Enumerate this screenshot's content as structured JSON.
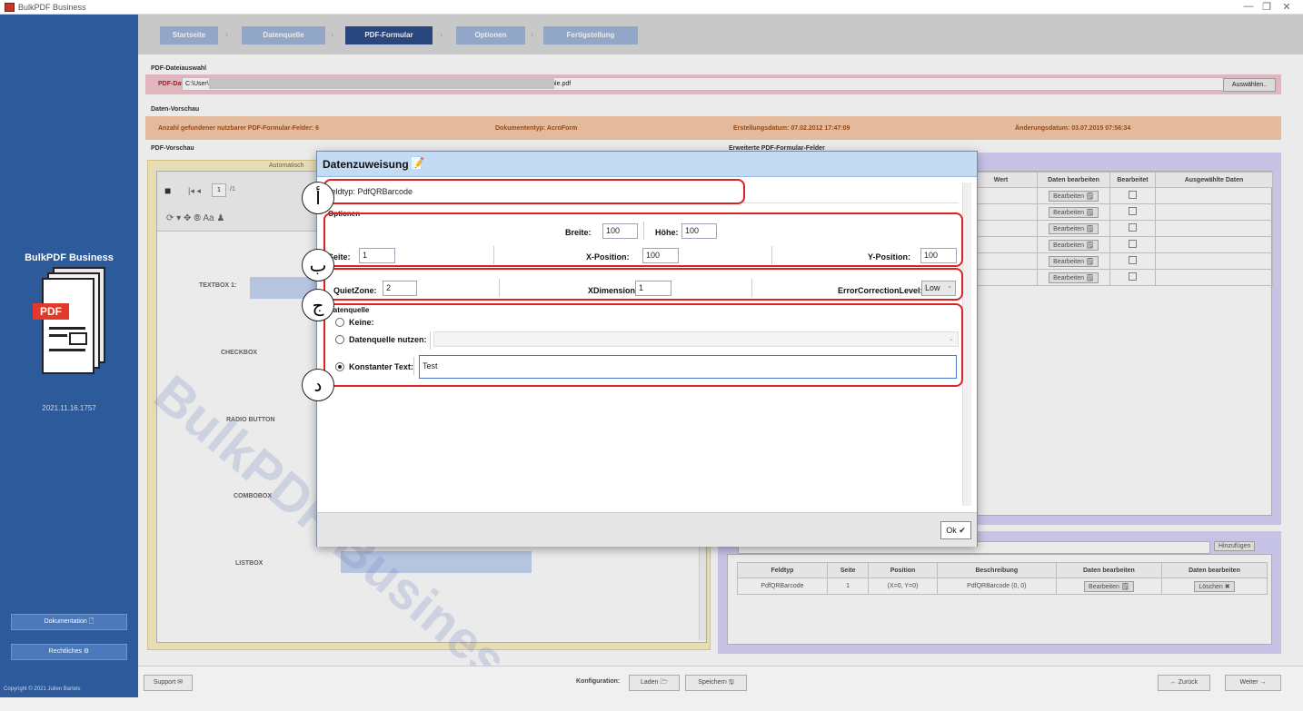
{
  "window": {
    "title": "BulkPDF Business",
    "controls": [
      "—",
      "❐",
      "✕"
    ]
  },
  "sidebar": {
    "brand": "BulkPDF Business",
    "logo_badge": "PDF",
    "version": "2021.11.16.1757",
    "docs_button": "Dokumentation 🗋",
    "legal_button": "Rechtliches ⚙",
    "copyright": "Copyright © 2021 Julien Bartels"
  },
  "steps": [
    "Startseite",
    "Datenquelle",
    "PDF-Formular",
    "Optionen",
    "Fertigstellung"
  ],
  "pdf_selection": {
    "section_label": "PDF-Dateiauswahl",
    "file_label": "PDF-Datei:",
    "path_start": "C:\\User\\",
    "path_end": "\\PDF-Example.pdf",
    "select_button": "Auswählen.."
  },
  "data_preview": {
    "section_label": "Daten-Vorschau",
    "fields_count": "Anzahl gefundener nutzbarer PDF-Formular-Felder: 6",
    "doc_type": "Dokumententyp: AcroForm",
    "created": "Erstellungsdatum: 07.02.2012 17:47:09",
    "modified": "Änderungsdatum: 03.07.2015 07:56:34"
  },
  "pdf_preview": {
    "section_label": "PDF-Vorschau",
    "auto_label": "Automatisch",
    "page_input": "1",
    "page_total": "/1",
    "form_labels": [
      "TEXTBOX 1:",
      "CHECKBOX",
      "RADIO BUTTON",
      "COMBOBOX",
      "LISTBOX"
    ],
    "watermark": "BulkPDF Business"
  },
  "field_table": {
    "section_label": "Erweiterte PDF-Formular-Felder",
    "headers": [
      "Wert",
      "Daten bearbeiten",
      "Bearbeitet",
      "Ausgewählte Daten"
    ],
    "edit_label": "Bearbeiten 🗒",
    "row_count": 6
  },
  "barcode_table": {
    "add_button": "Hinzufügen",
    "headers": [
      "Feldtyp",
      "Seite",
      "Position",
      "Beschreibung",
      "Daten bearbeiten",
      "Daten bearbeiten"
    ],
    "rows": [
      {
        "type": "PdfQRBarcode",
        "page": "1",
        "position": "(X=0, Y=0)",
        "description": "PdfQRBarcode (0, 0)",
        "edit": "Bearbeiten 🗒",
        "delete": "Löschen ✖"
      }
    ]
  },
  "bottom": {
    "support": "Support ✉",
    "config_label": "Konfiguration:",
    "load": "Laden 🗁",
    "save": "Speichern 🖫",
    "back": "← Zurück",
    "next": "Weiter →"
  },
  "dialog": {
    "title": "Datenzuweisung",
    "field_type": "Feldtyp: PdfQRBarcode",
    "options_label": "Optionen",
    "breite_label": "Breite:",
    "breite_value": "100",
    "hoehe_label": "Höhe:",
    "hoehe_value": "100",
    "seite_label": "Seite:",
    "seite_value": "1",
    "xpos_label": "X-Position:",
    "xpos_value": "100",
    "ypos_label": "Y-Position:",
    "ypos_value": "100",
    "quietzone_label": "QuietZone:",
    "quietzone_value": "2",
    "xdim_label": "XDimension:",
    "xdim_value": "1",
    "ecl_label": "ErrorCorrectionLevel:",
    "ecl_value": "Low",
    "source_label": "Datenquelle",
    "none_label": "Keine:",
    "use_source_label": "Datenquelle nutzen:",
    "const_label": "Konstanter Text:",
    "const_value": "Test",
    "ok": "Ok ✔"
  },
  "markers": [
    "أ",
    "ب",
    "ج",
    "د"
  ],
  "colors": {
    "sidebar": "#2d5a9a",
    "active_step": "#2d4d8a",
    "annotation": "#dd2222",
    "dialog_header": "#c4dbf4"
  }
}
